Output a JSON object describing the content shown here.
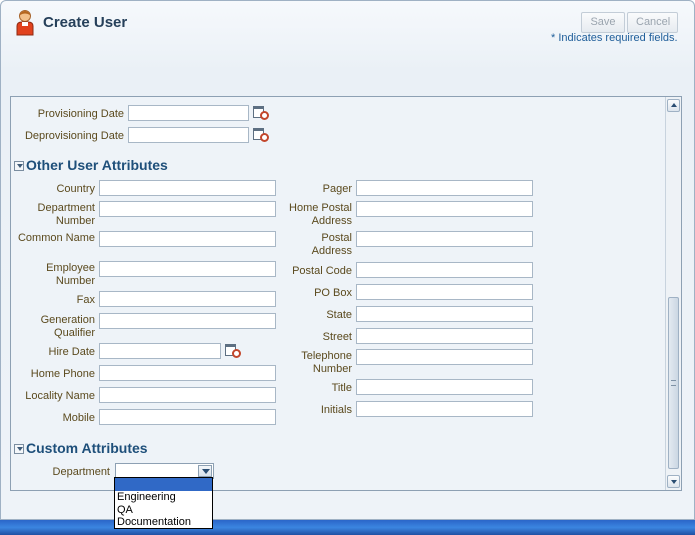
{
  "dialog": {
    "title": "Create User",
    "save_label": "Save",
    "cancel_label": "Cancel",
    "required_note": "* Indicates required fields."
  },
  "account": {
    "provisioning_date_label": "Provisioning Date",
    "deprovisioning_date_label": "Deprovisioning Date"
  },
  "other_attributes": {
    "title": "Other User Attributes",
    "left_fields": [
      "Country",
      "Department Number",
      "Common Name",
      "Employee Number",
      "Fax",
      "Generation Qualifier",
      "Hire Date",
      "Home Phone",
      "Locality Name",
      "Mobile"
    ],
    "right_fields": [
      "Pager",
      "Home Postal Address",
      "Postal Address",
      "Postal Code",
      "PO Box",
      "State",
      "Street",
      "Telephone Number",
      "Title",
      "Initials"
    ]
  },
  "custom_attributes": {
    "title": "Custom Attributes",
    "department_label": "Department",
    "department_value": "",
    "department_options": [
      "",
      "Engineering",
      "QA",
      "Documentation"
    ]
  },
  "icons": {
    "user": "user-icon",
    "calendar": "calendar-clock-icon",
    "collapse": "collapse-triangle-icon"
  },
  "colors": {
    "title": "#26405a",
    "section": "#1e4f7a",
    "label": "#5b4a1e",
    "note": "#1e5d99",
    "selection": "#3069c6"
  }
}
